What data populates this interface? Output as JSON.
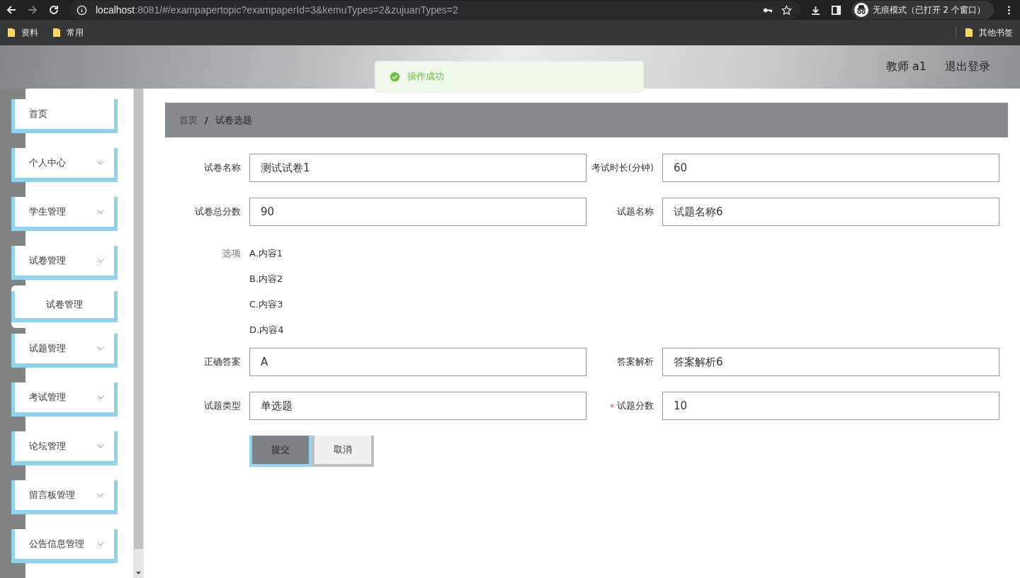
{
  "browser": {
    "url_host": "localhost",
    "url_rest": ":8081/#/exampapertopic?exampaperId=3&kemuTypes=2&zujuanTypes=2",
    "incognito_label": "无痕模式（已打开 2 个窗口）",
    "bookmarks": [
      "资料",
      "常用"
    ],
    "other_bookmarks": "其他书签"
  },
  "header": {
    "user": "教师 a1",
    "logout": "退出登录"
  },
  "toast": {
    "kind": "success",
    "message": "操作成功"
  },
  "sidebar": {
    "items": [
      {
        "label": "首页",
        "kind": "link"
      },
      {
        "label": "个人中心",
        "kind": "submenu"
      },
      {
        "label": "学生管理",
        "kind": "submenu"
      },
      {
        "label": "试卷管理",
        "kind": "submenu",
        "children": [
          {
            "label": "试卷管理",
            "selected": true
          }
        ]
      },
      {
        "label": "试题管理",
        "kind": "submenu"
      },
      {
        "label": "考试管理",
        "kind": "submenu"
      },
      {
        "label": "论坛管理",
        "kind": "submenu"
      },
      {
        "label": "留言板管理",
        "kind": "submenu"
      },
      {
        "label": "公告信息管理",
        "kind": "submenu"
      }
    ]
  },
  "breadcrumb": {
    "separator": "/",
    "items": [
      "首页",
      "试卷选题"
    ]
  },
  "form": {
    "fields_top": [
      {
        "label": "试卷名称",
        "value": "测试试卷1",
        "required": false
      },
      {
        "label": "考试时长(分钟)",
        "value": "60",
        "required": false
      },
      {
        "label": "试卷总分数",
        "value": "90",
        "required": false
      },
      {
        "label": "试题名称",
        "value": "试题名称6",
        "required": false
      }
    ],
    "options": {
      "label": "选项",
      "items": [
        "A.内容1",
        "B.内容2",
        "C.内容3",
        "D.内容4"
      ]
    },
    "fields_bottom": [
      {
        "label": "正确答案",
        "value": "A",
        "required": false
      },
      {
        "label": "答案解析",
        "value": "答案解析6",
        "required": false
      },
      {
        "label": "试题类型",
        "value": "单选题",
        "required": false
      },
      {
        "label": "试题分数",
        "value": "10",
        "required": true
      }
    ],
    "buttons": [
      {
        "label": "提交",
        "kind": "primary"
      },
      {
        "label": "取消",
        "kind": "default"
      }
    ]
  }
}
